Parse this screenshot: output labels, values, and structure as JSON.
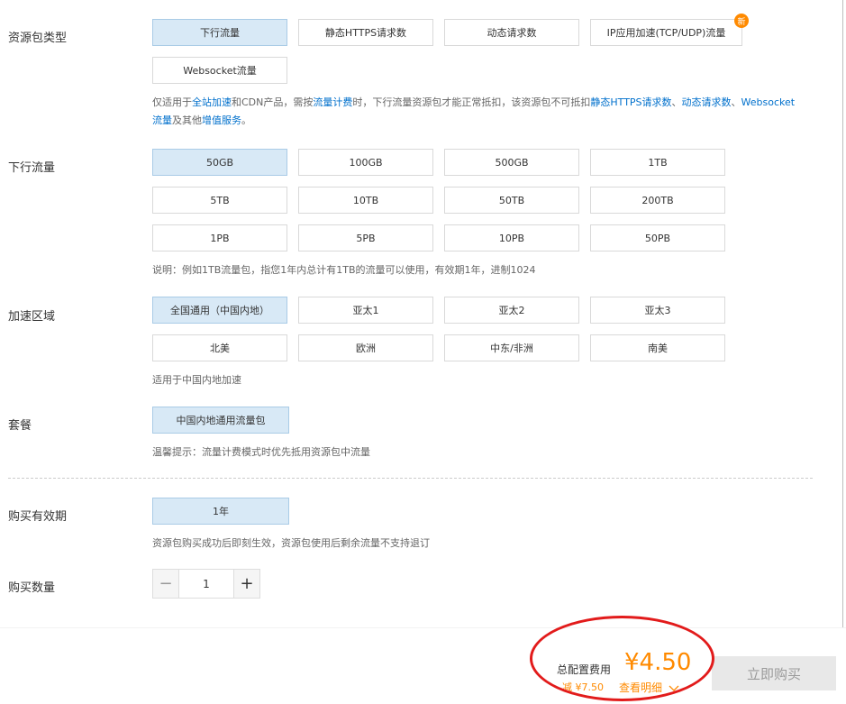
{
  "package_type": {
    "label": "资源包类型",
    "options": [
      "下行流量",
      "静态HTTPS请求数",
      "动态请求数",
      "IP应用加速(TCP/UDP)流量",
      "Websocket流量"
    ],
    "selected": 0,
    "new_badge": "新",
    "note": {
      "p1": "仅适用于",
      "l1": "全站加速",
      "p2": "和CDN产品，需按",
      "l2": "流量计费",
      "p3": "时，下行流量资源包才能正常抵扣，该资源包不可抵扣",
      "l3": "静态HTTPS请求数",
      "p4": "、",
      "l4": "动态请求数",
      "p5": "、",
      "l5": "Websocket流量",
      "p6": "及其他",
      "l6": "增值服务",
      "p7": "。"
    }
  },
  "traffic": {
    "label": "下行流量",
    "options": [
      "50GB",
      "100GB",
      "500GB",
      "1TB",
      "5TB",
      "10TB",
      "50TB",
      "200TB",
      "1PB",
      "5PB",
      "10PB",
      "50PB"
    ],
    "selected": 0,
    "note": "说明：例如1TB流量包，指您1年内总计有1TB的流量可以使用，有效期1年，进制1024"
  },
  "region": {
    "label": "加速区域",
    "options": [
      "全国通用（中国内地）",
      "亚太1",
      "亚太2",
      "亚太3",
      "北美",
      "欧洲",
      "中东/非洲",
      "南美"
    ],
    "selected": 0,
    "note": "适用于中国内地加速"
  },
  "plan": {
    "label": "套餐",
    "options": [
      "中国内地通用流量包"
    ],
    "selected": 0,
    "note": "温馨提示：流量计费模式时优先抵用资源包中流量"
  },
  "validity": {
    "label": "购买有效期",
    "options": [
      "1年"
    ],
    "selected": 0,
    "note": "资源包购买成功后即刻生效，资源包使用后剩余流量不支持退订"
  },
  "quantity": {
    "label": "购买数量",
    "minus": "−",
    "plus": "+",
    "value": "1"
  },
  "footer": {
    "total_label": "总配置费用",
    "price": "¥4.50",
    "discount": "减 ¥7.50",
    "detail": "查看明细",
    "buy_button": "立即购买"
  },
  "colors": {
    "accent": "#ff8a00",
    "link": "#0070cc",
    "selected_bg": "#d8e9f6",
    "annotation_circle": "#e21b1b"
  }
}
